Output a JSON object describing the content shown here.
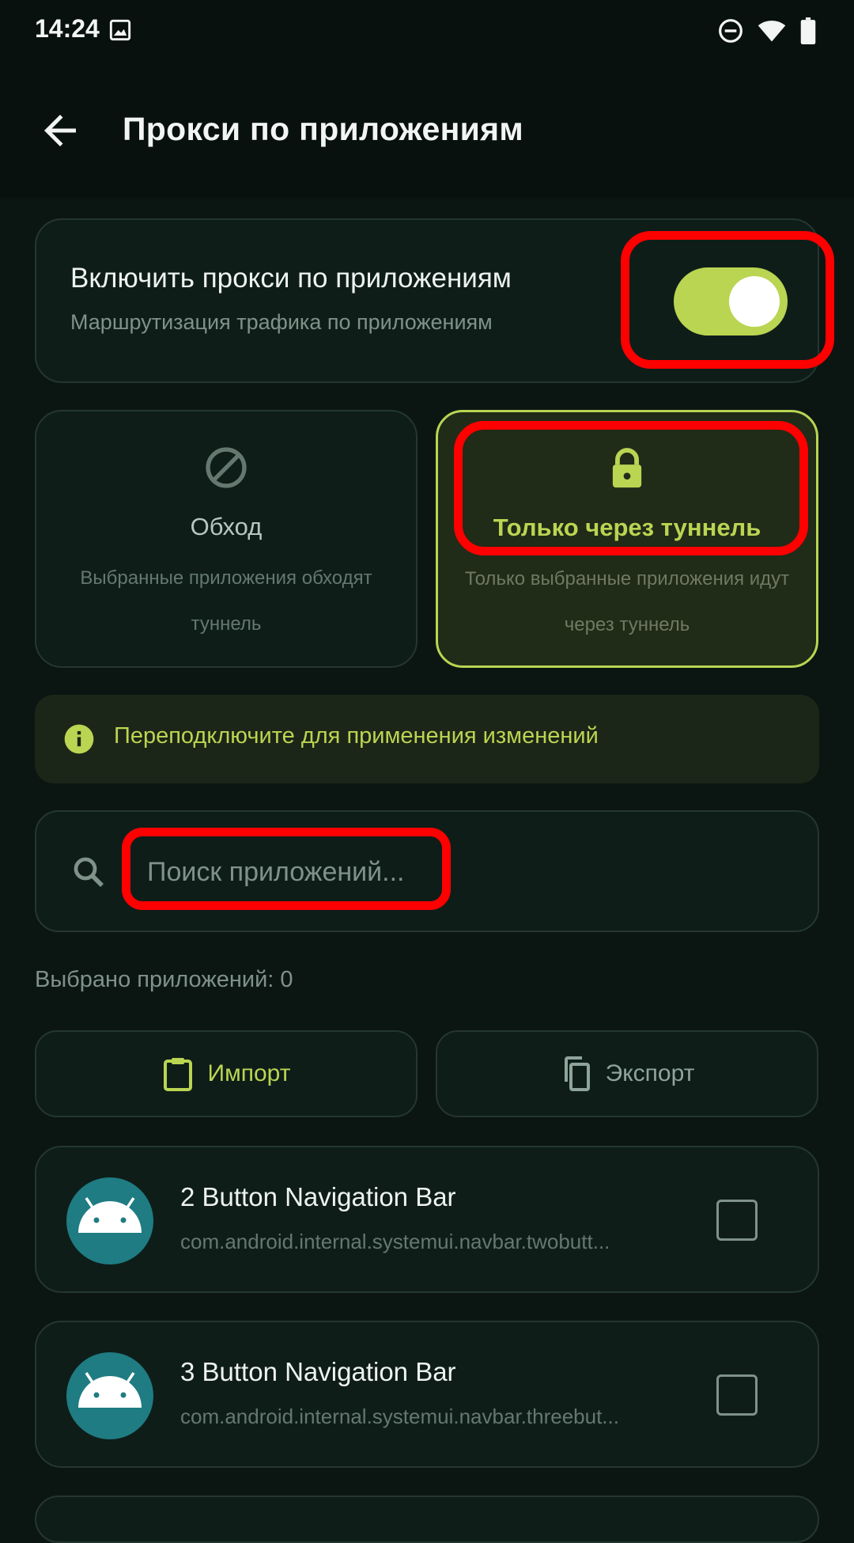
{
  "status_bar": {
    "time": "14:24",
    "icons": [
      "image-icon",
      "dnd-icon",
      "wifi-icon",
      "battery-icon"
    ]
  },
  "header": {
    "title": "Прокси по приложениям",
    "back_icon": "arrow-left-icon"
  },
  "toggle": {
    "title": "Включить прокси по приложениям",
    "subtitle": "Маршрутизация трафика по приложениям",
    "enabled": true
  },
  "modes": [
    {
      "label": "Обход",
      "description": "Выбранные приложения обходят туннель",
      "icon": "block-icon",
      "selected": false
    },
    {
      "label": "Только через туннель",
      "description": "Только выбранные приложения идут через туннель",
      "icon": "lock-icon",
      "selected": true
    }
  ],
  "info": {
    "text": "Переподключите для применения изменений",
    "icon": "info-icon"
  },
  "search": {
    "placeholder": "Поиск приложений...",
    "value": ""
  },
  "selected_count": "Выбрано приложений: 0",
  "actions": {
    "import_label": "Импорт",
    "export_label": "Экспорт"
  },
  "apps": [
    {
      "name": "2 Button Navigation Bar",
      "package": "com.android.internal.systemui.navbar.twobutt...",
      "checked": false
    },
    {
      "name": "3 Button Navigation Bar",
      "package": "com.android.internal.systemui.navbar.threebut...",
      "checked": false
    }
  ],
  "colors": {
    "accent": "#b9d552",
    "background": "#0b1613",
    "card": "#0f1d19",
    "app_icon_bg": "#1e7c82",
    "highlight": "#ff0000"
  }
}
